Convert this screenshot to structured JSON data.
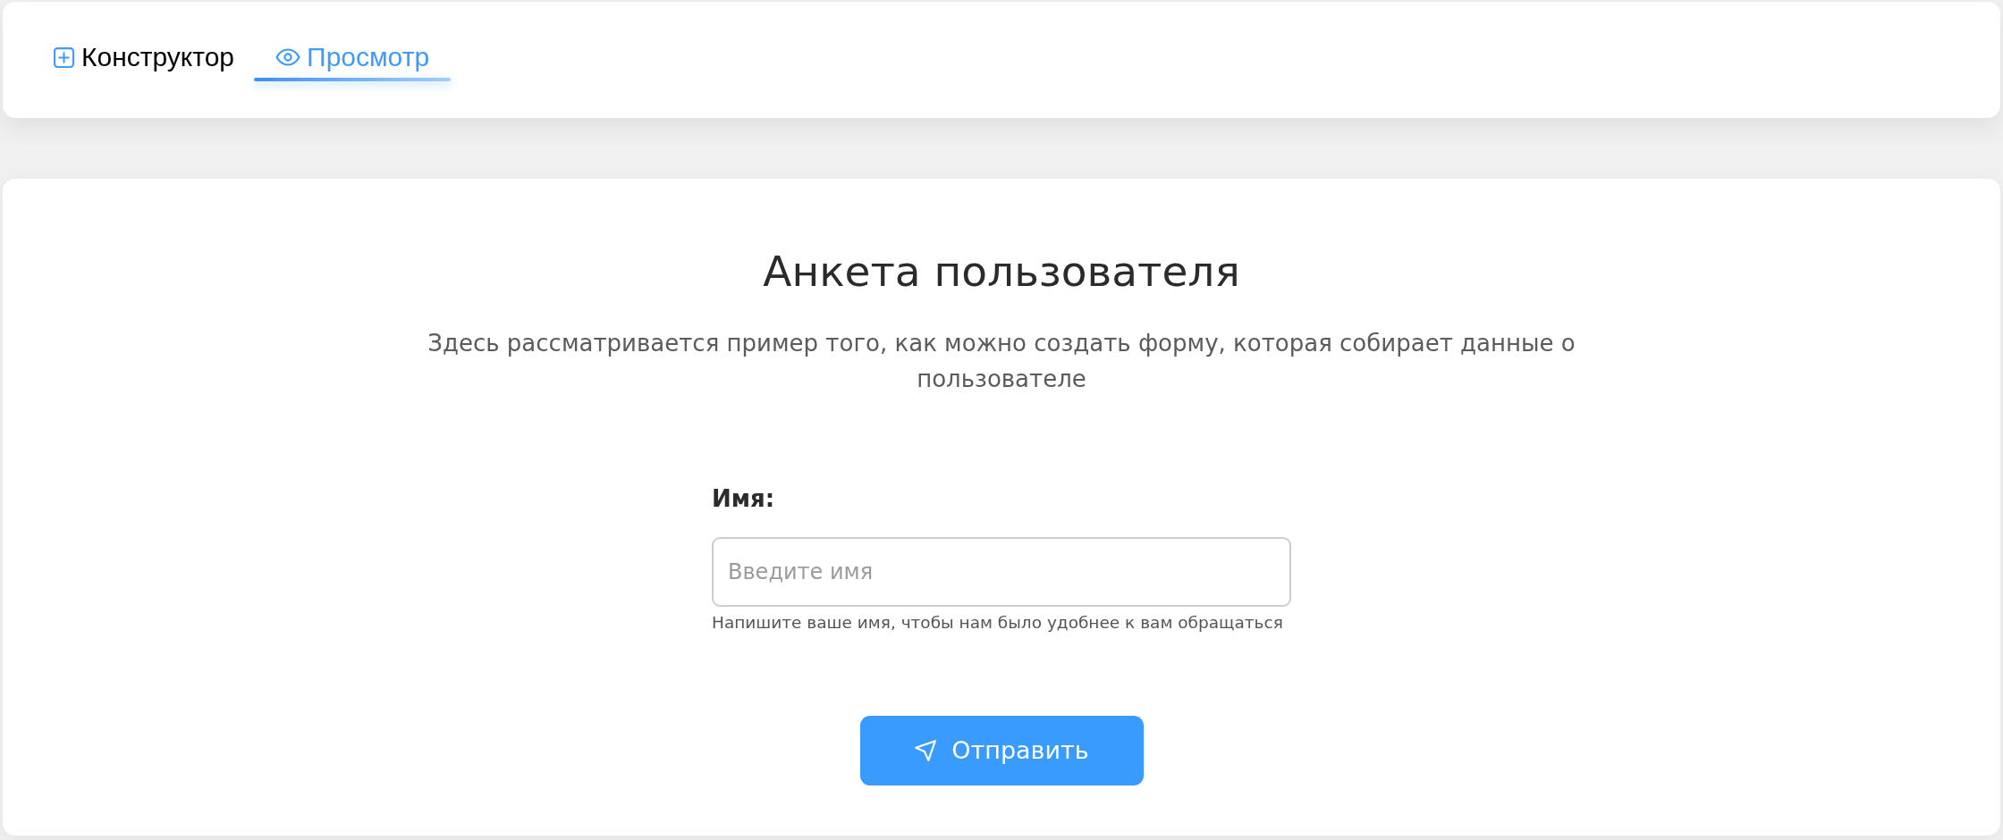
{
  "tabs": [
    {
      "kind": "add",
      "label": "Конструктор",
      "selected": false
    },
    {
      "kind": "view",
      "label": "Просмотр",
      "selected": true
    }
  ],
  "form": {
    "title": "Анкета пользователя",
    "description": "Здесь рассматривается пример того, как можно создать форму, которая собирает данные о пользователе",
    "fields": [
      {
        "label": "Имя:",
        "placeholder": "Введите имя",
        "hint": "Напишите ваше имя, чтобы нам было удобнее к вам обращаться"
      }
    ],
    "submit": {
      "label": "Отправить"
    }
  }
}
